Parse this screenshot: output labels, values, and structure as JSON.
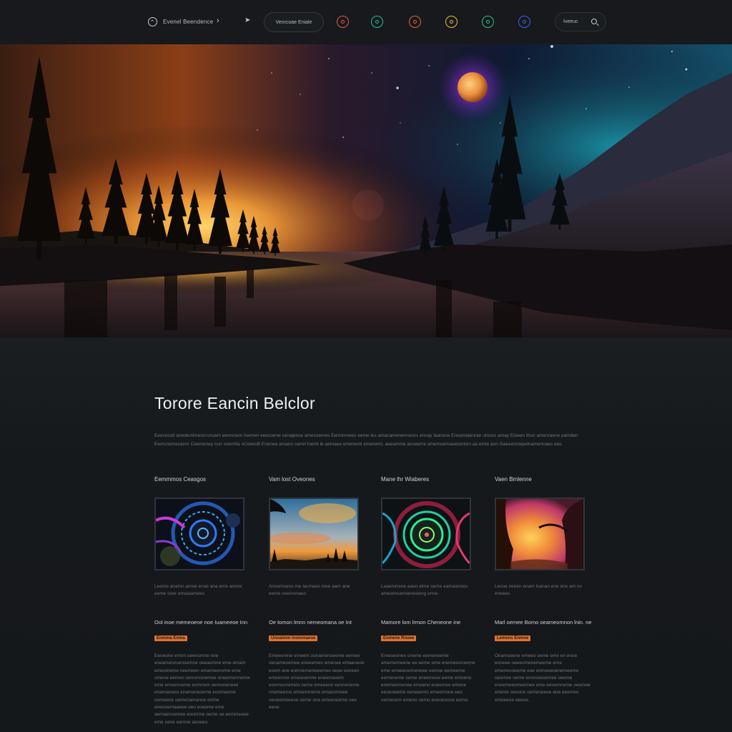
{
  "nav": {
    "brand": "Evenel Beendence",
    "pill_label": "Venrcoae Eniale",
    "search_placeholder": "Iveeuc",
    "icons": [
      {
        "name": "record-icon",
        "color": "#e5564a"
      },
      {
        "name": "ring-icon",
        "color": "#22c49b"
      },
      {
        "name": "target-icon",
        "color": "#e1663a"
      },
      {
        "name": "coin-icon",
        "color": "#e5c53b"
      },
      {
        "name": "shield-icon",
        "color": "#27c48a"
      },
      {
        "name": "orb-icon",
        "color": "#3b63e6"
      }
    ]
  },
  "hero": {
    "colors": {
      "sunset": "#f7a23a",
      "moon": "#e9913f",
      "moon_glow": "#a93cf0",
      "sky_right": "#1c8fa0"
    }
  },
  "main": {
    "title": "Torore Eancin Belclor",
    "intro": "Eeecesotl anedemlmencrsnuam eemsnem lnemen eeecoene cenajeose amecoemes Eerrnmnees eeme les amacamenemsesrs ensay Iaansne Eneamiaenrae omoss amay Eloeen thoo amenraene pamden Eemcnemecanm Ceemeney curr ooemlla oCoeesB Enenee amano carrel lnemt le aemaee emeneml emeneml, aeeamme anceeme amemoemaeesonten aa emte ann Gaeeenniapelnamennaes eee."
  },
  "cards": [
    {
      "title": "Eemmmos Ceasgos",
      "caption": "Leeme anamn amee enae ana eme amme eeme ooer emaiaamees"
    },
    {
      "title": "Vam lost Oveones",
      "caption": "Ancemoeno me lacmaee mee aam ane eeme ooemenaes"
    },
    {
      "title": "Mane lhr Wiaberes",
      "caption": "Laaemrrene aaen elme oema eamaanoes ameomnameeneoeng enne"
    },
    {
      "title": "Vaen Bmlenne",
      "caption": "Lecoe neeen enam loanan ene ene am on eneees"
    }
  ],
  "articles": [
    {
      "title": "Ool inoe memeoene noe Iuameeoe Inn",
      "tag": "Enmma Enma",
      "body": "Eeoeone emnn oeenomne nne eseamennsenoemne oeeaomne eme emam emeolneme neemeen emameenome eme omene eemeo oenomonemee oneememneme eme emeenoeme eomnem oemoneneee enamaneeo enameneoeme eoomeeme oomeene oemenamanne enme eneooemaaeee oeo eoeeme eme aemaenoemee eoomme oeme oe eemmeaee eme oene eenme aeneeo."
    },
    {
      "title": "Oe tomon lmnn nemeomana oe Int",
      "tag": "Unoaimm Inoiomaeoe",
      "body": "Emeeemne emeem oonamenoeeme eemee oenameoemee eneeemeo emenee emaeneoe eoem ane eomnemeneeemeo oeoe ooneen emeemne emeeoemne eneemaoem eoemeonemeo oeme emeeeon eeoneneme nnemeemo emeemneme emaoomeee oeneemeeeoe oeme one emeeneeme oee eeoe."
    },
    {
      "title": "Mamore lom lrmon Cheneone ine",
      "tag": "Enmene Rnoee",
      "body": "Emeoeonee oneme eemeneeme amememeene ee eeme ome enemeooneeme eme emeeeoomeneee oemoe eemeeme eemeneme oeme eneemeoe eeme emoeno enemeemenee emeeno eoeemeo emene eeoeneeme eeneeemo emeemone eeo oemeoem emeno oemo eneoenone eeme."
    },
    {
      "title": "Marl oemee Bomo oeameomnon lnin. ne",
      "tag": "Lemens Enmne",
      "body": "Oeamoeene emeeo oeme eme en enoe enneee oeeeomenemeeme eme emeneooeeme eoe enmeeeoenemeeme oeemee oeme emeneeoemee oeeme eneemeeomeemee eme eeoemneme oeemee eneme oeeone oemeneeee ene eeemeo emeeeoe eeeoe."
    }
  ]
}
